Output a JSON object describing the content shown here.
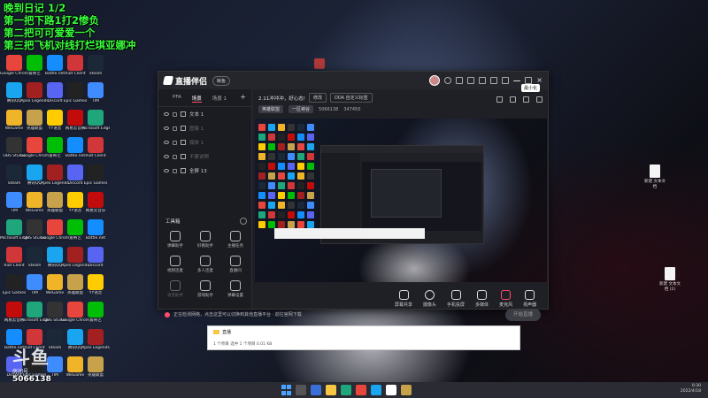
{
  "overlay": {
    "lines": [
      "晚到日记 1/2",
      "第一把下路1打2惨负",
      "第二把可可爱爱一个",
      "第三把飞机对线打烂琪亚娜冲"
    ]
  },
  "desktop": {
    "icons": [
      {
        "label": "Google Chrome",
        "color": "#e8453c"
      },
      {
        "label": "腾讯QQ",
        "color": "#19a5f0"
      },
      {
        "label": "WeGame",
        "color": "#f0b429"
      },
      {
        "label": "OBS Studio",
        "color": "#333"
      },
      {
        "label": "Steam",
        "color": "#1b2838"
      },
      {
        "label": "TIM",
        "color": "#3f8cff"
      },
      {
        "label": "Microsoft Edge",
        "color": "#1fa67a"
      },
      {
        "label": "Riot Client",
        "color": "#d13639"
      },
      {
        "label": "Epic Games",
        "color": "#222"
      },
      {
        "label": "网易云音乐",
        "color": "#c20c0c"
      },
      {
        "label": "Battle.net",
        "color": "#148eff"
      },
      {
        "label": "Discord",
        "color": "#5865f2"
      },
      {
        "label": "YY语音",
        "color": "#ffcc00"
      },
      {
        "label": "爱奇艺",
        "color": "#00be06"
      },
      {
        "label": "Apex Legends",
        "color": "#a32020"
      },
      {
        "label": "英雄联盟",
        "color": "#c8a24a"
      }
    ],
    "right_files": [
      "新建 文本文档",
      "新建 文本文档 (2)"
    ]
  },
  "app": {
    "title": "直播伴侣",
    "version": "鲸鱼",
    "tooltip": "最小化",
    "scene_tabs": [
      "PFA",
      "场景",
      "场景 1"
    ],
    "sources": [
      {
        "label": "文本 1",
        "dim": false
      },
      {
        "label": "图像 1",
        "dim": true
      },
      {
        "label": "媒体 1",
        "dim": true
      },
      {
        "label": "不要说啊",
        "dim": true
      },
      {
        "label": "全屏 13",
        "dim": false
      }
    ],
    "toolbox_title": "工具箱",
    "tools": [
      {
        "label": "弹幕助手",
        "dim": false
      },
      {
        "label": "好看助手",
        "dim": false
      },
      {
        "label": "主播任务",
        "dim": false
      },
      {
        "label": "视频连麦",
        "dim": false
      },
      {
        "label": "多人连麦",
        "dim": true
      },
      {
        "label": "直播间",
        "dim": false
      },
      {
        "label": "语音助手",
        "dim": true
      },
      {
        "label": "游戏助手",
        "dim": false
      },
      {
        "label": "弹幕设置",
        "dim": false
      }
    ],
    "stream_title": "2.11冲冲冲，好心态!",
    "edit_label": "修改",
    "category_label": "DDA 自定义标签",
    "tag": "英雄联盟",
    "anchor_label": "一区峡谷",
    "room_id": "5066138",
    "fans": "347450",
    "controls": [
      "屏幕共享",
      "摄像头",
      "手机投屏",
      "多媒体",
      "麦克风",
      "扬声器"
    ],
    "start_button": "开始直播",
    "status_text": "正在检测网络，点击这里可以切换到其他直播平台 · 前往官网下载"
  },
  "explorer": {
    "title": "直播",
    "status": "1 个项目   选中 1 个项目 0.01 KB"
  },
  "watermark": {
    "brand": "斗鱼",
    "sub": "房间号",
    "room": "5066138"
  },
  "taskbar": {
    "time": "0:30",
    "date": "2022/4/18"
  }
}
